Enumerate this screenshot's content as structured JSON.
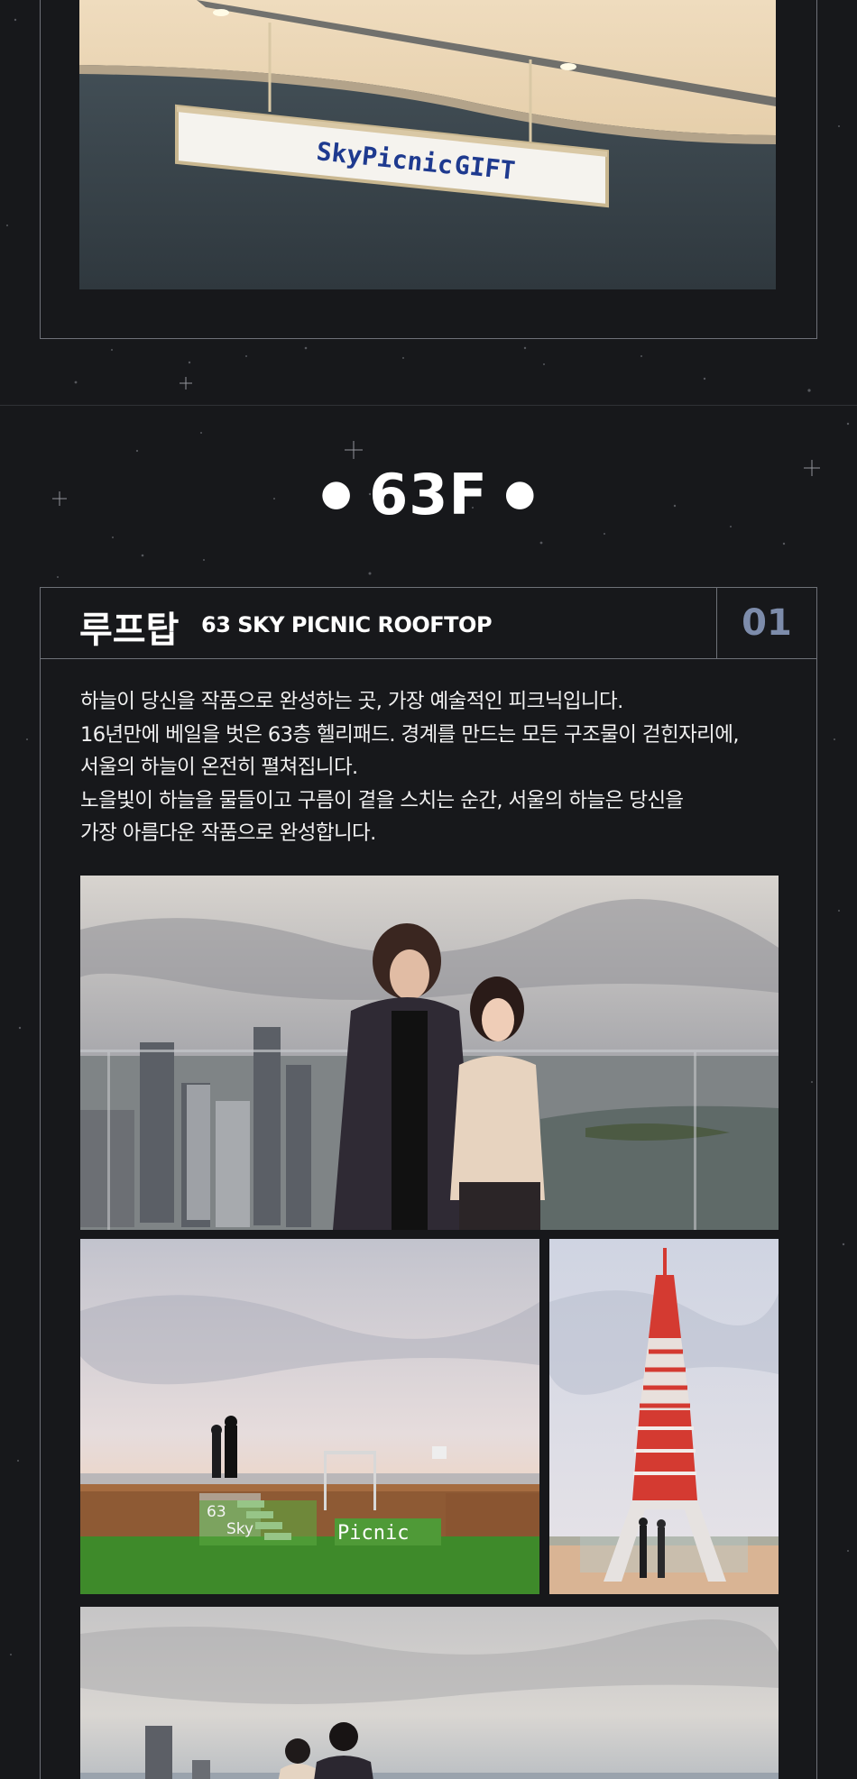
{
  "gift_sign": {
    "text_a": "SkyPicnic",
    "text_b": "GIFT"
  },
  "floor": {
    "label": "63F"
  },
  "rooftop": {
    "title": "루프탑",
    "subtitle": "63 SKY PICNIC ROOFTOP",
    "number": "01",
    "description": [
      "하늘이 당신을 작품으로 완성하는 곳, 가장 예술적인 피크닉입니다.",
      "16년만에 베일을 벗은 63층 헬리패드. 경계를 만드는 모든 구조물이 걷힌자리에,",
      "서울의 하늘이 온전히 펼쳐집니다.",
      "노을빛이 하늘을  물들이고 구름이 곁을 스치는 순간, 서울의 하늘은 당신을",
      "가장 아름다운 작품으로 완성합니다."
    ],
    "photos": {
      "picnic_sign_a": "63",
      "picnic_sign_b": "Sky",
      "picnic_sign_c": "Picnic"
    }
  },
  "colors": {
    "background": "#17181b",
    "border": "#6e7178",
    "accent_number": "#7d8cab"
  },
  "icons": [
    "dot-bullet-icon"
  ]
}
